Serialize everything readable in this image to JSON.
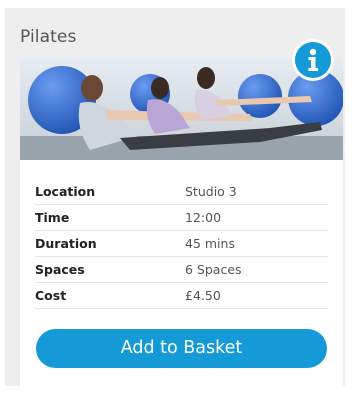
{
  "class_card": {
    "title": "Pilates",
    "info_icon": "info-icon",
    "photo_description_icon": "pilates-class-photo",
    "details": [
      {
        "label": "Location",
        "value": "Studio 3"
      },
      {
        "label": "Time",
        "value": "12:00"
      },
      {
        "label": "Duration",
        "value": "45 mins"
      },
      {
        "label": "Spaces",
        "value": "6 Spaces"
      },
      {
        "label": "Cost",
        "value": "£4.50"
      }
    ],
    "add_button_label": "Add to Basket"
  },
  "colors": {
    "accent": "#149ad6",
    "card_background": "#eeeeef",
    "panel_background": "#ffffff"
  }
}
